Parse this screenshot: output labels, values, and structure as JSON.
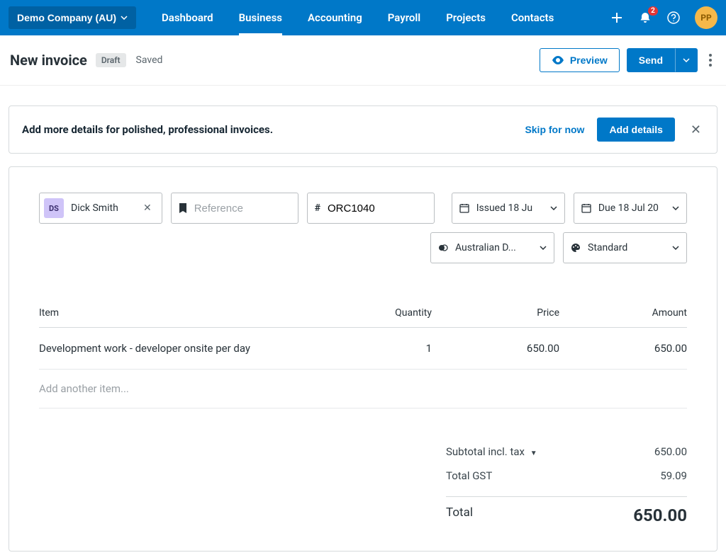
{
  "nav": {
    "company": "Demo Company (AU)",
    "items": [
      "Dashboard",
      "Business",
      "Accounting",
      "Payroll",
      "Projects",
      "Contacts"
    ],
    "activeIndex": 1,
    "notificationCount": "2",
    "avatarInitials": "PP"
  },
  "header": {
    "title": "New invoice",
    "status": "Draft",
    "saved": "Saved",
    "preview": "Preview",
    "send": "Send"
  },
  "banner": {
    "text": "Add more details for polished, professional invoices.",
    "skip": "Skip for now",
    "addDetails": "Add details"
  },
  "form": {
    "contactInitials": "DS",
    "contactName": "Dick Smith",
    "referencePlaceholder": "Reference",
    "invoiceNumber": "ORC1040",
    "issuedDate": "Issued 18 Ju",
    "dueDate": "Due 18 Jul 20",
    "currency": "Australian D...",
    "template": "Standard"
  },
  "table": {
    "headers": {
      "item": "Item",
      "qty": "Quantity",
      "price": "Price",
      "amount": "Amount"
    },
    "rows": [
      {
        "item": "Development work - developer onsite per day",
        "qty": "1",
        "price": "650.00",
        "amount": "650.00"
      }
    ],
    "addAnother": "Add another item..."
  },
  "totals": {
    "subtotalLabel": "Subtotal incl. tax",
    "subtotal": "650.00",
    "gstLabel": "Total GST",
    "gst": "59.09",
    "totalLabel": "Total",
    "total": "650.00"
  }
}
